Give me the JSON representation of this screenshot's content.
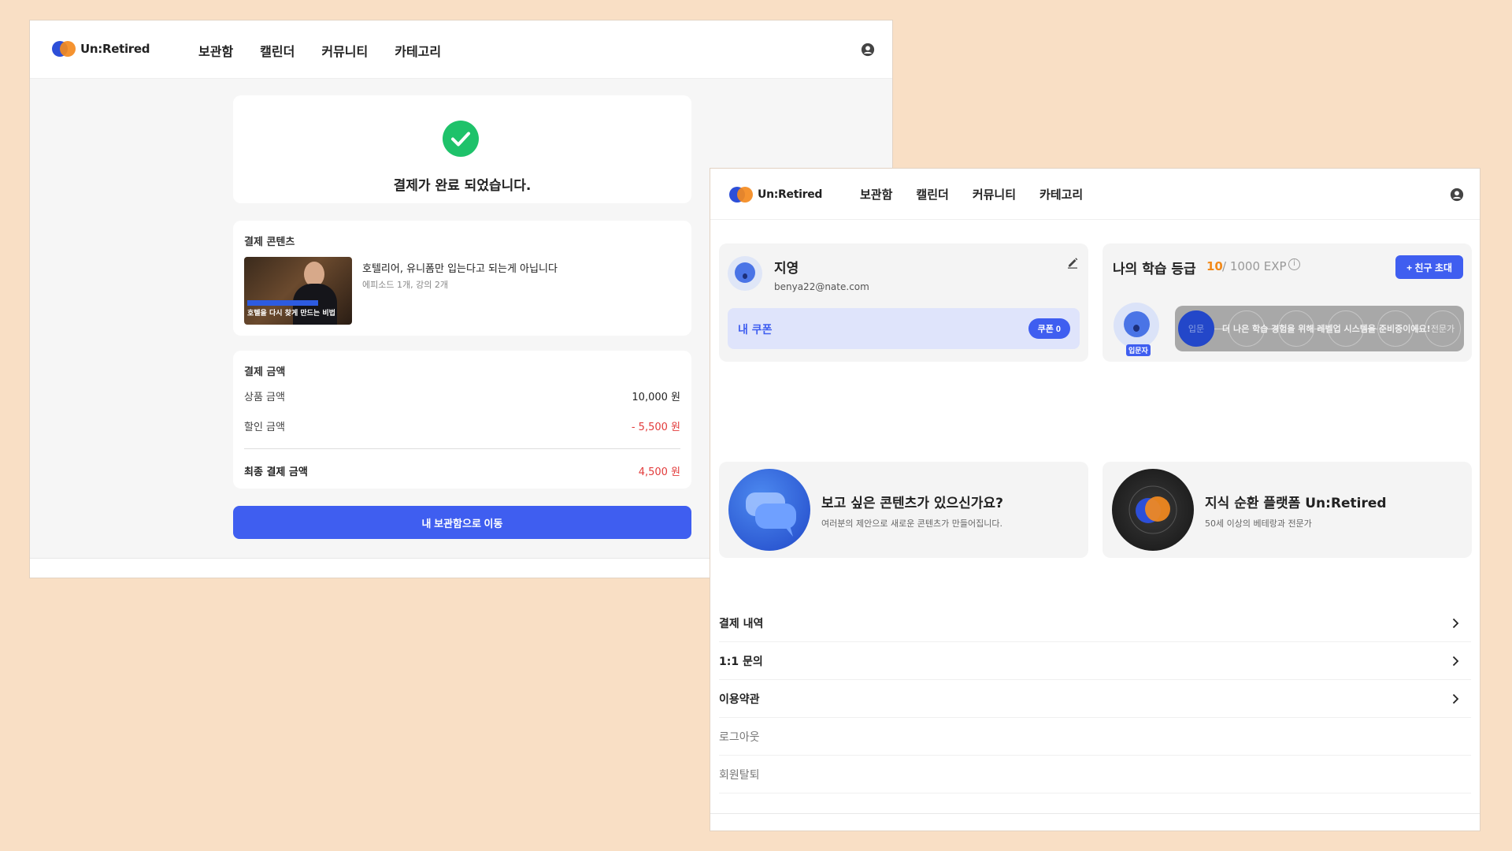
{
  "brand": {
    "name": "Un:Retired",
    "colors": {
      "blue": "#2d4fd8",
      "orange": "#f48a1e",
      "accent": "#3f5ef0",
      "success": "#1ec26a",
      "discount": "#e23b3b",
      "background": "#f9dfc5"
    }
  },
  "nav": [
    "보관함",
    "캘린더",
    "커뮤니티",
    "카테고리"
  ],
  "icons": {
    "user": "user-circle-icon",
    "check": "check-circle-icon",
    "edit": "pencil-icon",
    "info": "info-icon",
    "chevron": "chevron-right-icon"
  },
  "payment": {
    "success_message": "결제가 완료 되었습니다.",
    "content_section_title": "결제 콘텐츠",
    "item": {
      "title": "호텔리어, 유니폼만 입는다고 되는게 아닙니다",
      "subtitle": "에피소드 1개, 강의 2개",
      "thumbnail_caption": "호텔을 다시 찾게 만드는 비법"
    },
    "amount_section_title": "결제 금액",
    "rows": [
      {
        "label": "상품 금액",
        "value": "10,000 원"
      },
      {
        "label": "할인 금액",
        "value": "- 5,500 원"
      },
      {
        "label": "최종 결제 금액",
        "value": "4,500 원"
      }
    ],
    "cta_label": "내 보관함으로 이동"
  },
  "mypage": {
    "profile": {
      "name": "지영",
      "email": "benya22@nate.com"
    },
    "coupon": {
      "label": "내 쿠폰",
      "button": "쿠폰 0"
    },
    "grade": {
      "title": "나의 학습 등급",
      "level": "10",
      "exp": "/ 1000 EXP",
      "info": "i",
      "invite_label": "+ 친구 초대",
      "badge": "입문자",
      "start": "입문",
      "end": "전문가",
      "message": "더 나은 학습 경험을 위해 레벨업 시스템을 준비중이에요!"
    },
    "promos": [
      {
        "title": "보고 싶은 콘텐츠가 있으신가요?",
        "subtitle": "여러분의 제안으로 새로운 콘텐츠가 만들어집니다."
      },
      {
        "title": "지식 순환 플랫폼 Un:Retired",
        "subtitle": "50세 이상의 베테랑과 전문가"
      }
    ],
    "menu": [
      "결제 내역",
      "1:1 문의",
      "이용약관",
      "로그아웃",
      "회원탈퇴"
    ]
  }
}
